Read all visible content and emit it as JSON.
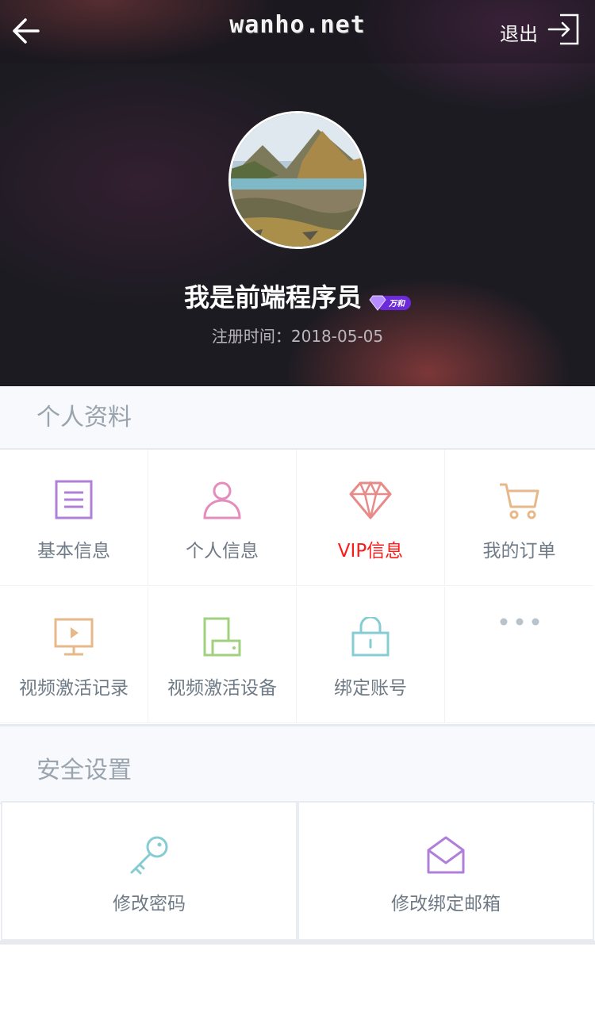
{
  "header": {
    "logo_text": "wanho.net",
    "logout_label": "退出",
    "back_icon": "arrow-left-icon",
    "logout_icon": "logout-icon"
  },
  "profile": {
    "nickname": "我是前端程序员",
    "badge_text": "万和",
    "register_label": "注册时间：2018-05-05"
  },
  "personal": {
    "title": "个人资料",
    "items": [
      {
        "label": "基本信息",
        "icon": "document-icon",
        "color": "#b07fd8"
      },
      {
        "label": "个人信息",
        "icon": "user-icon",
        "color": "#e48cbd"
      },
      {
        "label": "VIP信息",
        "icon": "diamond-icon",
        "color": "#e78a8a",
        "label_color": "#ff1a1a"
      },
      {
        "label": "我的订单",
        "icon": "cart-icon",
        "color": "#e7b98a"
      },
      {
        "label": "视频激活记录",
        "icon": "video-monitor-icon",
        "color": "#e7b98a"
      },
      {
        "label": "视频激活设备",
        "icon": "devices-icon",
        "color": "#9fd17f"
      },
      {
        "label": "绑定账号",
        "icon": "lock-icon",
        "color": "#86cdd3"
      },
      {
        "label": "",
        "icon": "more-icon",
        "color": "#b9c3cc"
      }
    ]
  },
  "security": {
    "title": "安全设置",
    "items": [
      {
        "label": "修改密码",
        "icon": "key-icon",
        "color": "#86cdd3"
      },
      {
        "label": "修改绑定邮箱",
        "icon": "mail-icon",
        "color": "#b07fd8"
      }
    ]
  }
}
